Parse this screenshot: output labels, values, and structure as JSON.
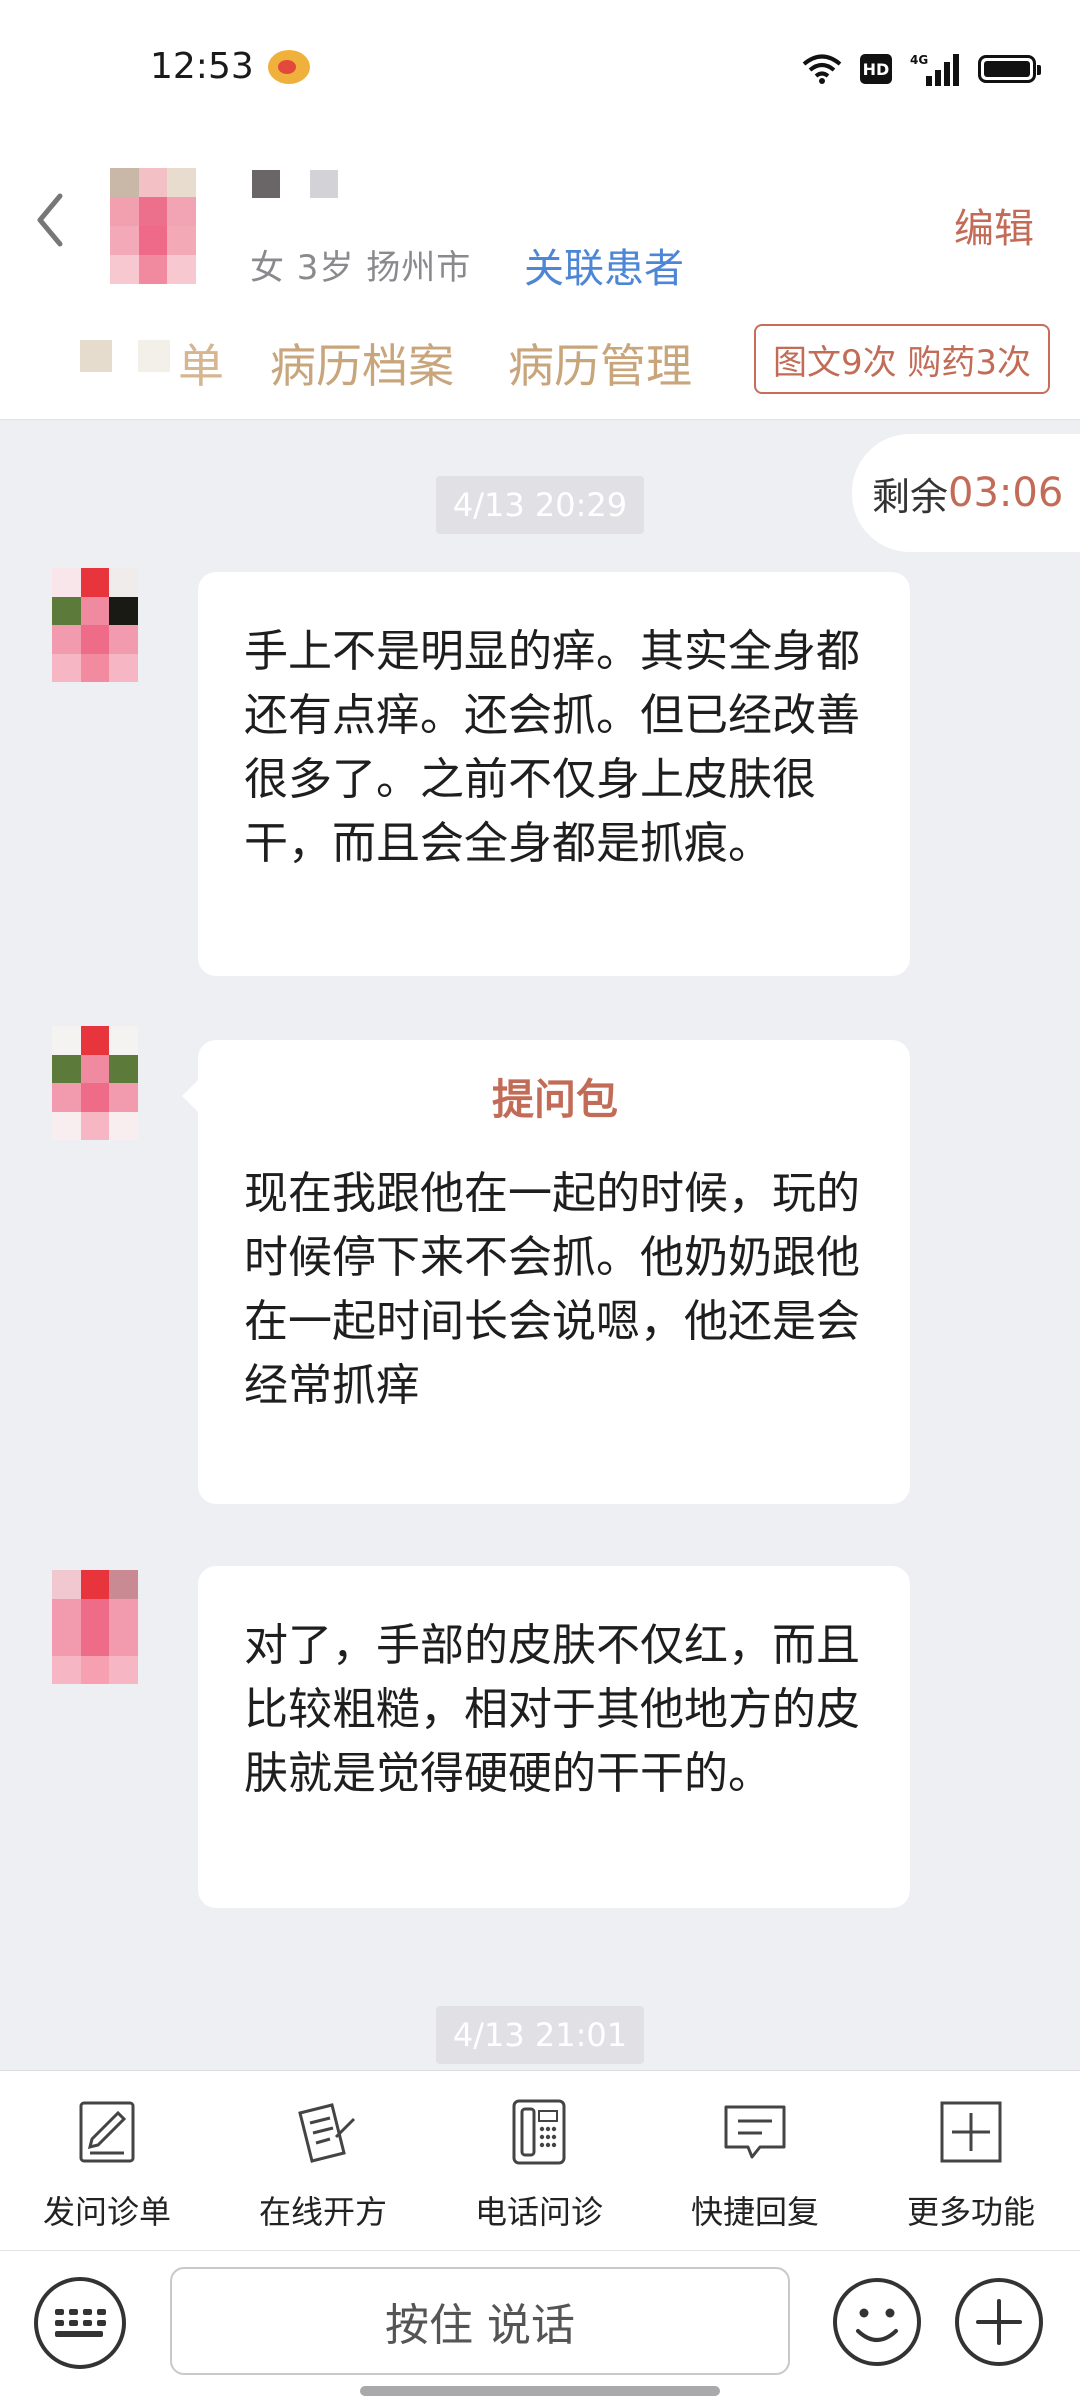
{
  "status_bar": {
    "time": "12:53",
    "hd_label": "HD",
    "network_label": "4G"
  },
  "header": {
    "patient_meta": "女 3岁  扬州市",
    "link_patient": "关联患者",
    "edit": "编辑",
    "tab_partial": "单",
    "tabs": [
      "病历档案",
      "病历管理"
    ],
    "stats_badge": "图文9次 购药3次"
  },
  "timer": {
    "label": "剩余",
    "value": "03:06"
  },
  "timestamps": [
    "4/13 20:29",
    "4/13 21:01"
  ],
  "messages": [
    {
      "title": "",
      "text": "手上不是明显的痒。其实全身都还有点痒。还会抓。但已经改善很多了。之前不仅身上皮肤很干，而且会全身都是抓痕。"
    },
    {
      "title": "提问包",
      "text": "现在我跟他在一起的时候，玩的时候停下来不会抓。他奶奶跟他在一起时间长会说嗯，他还是会经常抓痒"
    },
    {
      "title": "",
      "text": "对了，手部的皮肤不仅红，而且比较粗糙，相对于其他地方的皮肤就是觉得硬硬的干干的。"
    }
  ],
  "toolbar": {
    "items": [
      {
        "label": "发问诊单",
        "icon": "edit-form-icon"
      },
      {
        "label": "在线开方",
        "icon": "prescription-icon"
      },
      {
        "label": "电话问诊",
        "icon": "phone-icon"
      },
      {
        "label": "快捷回复",
        "icon": "quick-reply-icon"
      },
      {
        "label": "更多功能",
        "icon": "plus-square-icon"
      }
    ]
  },
  "input_bar": {
    "voice_label": "按住 说话"
  },
  "colors": {
    "accent": "#c26c58",
    "link": "#4d86d6",
    "tab": "#c9a57c",
    "background": "#eeeff3"
  }
}
